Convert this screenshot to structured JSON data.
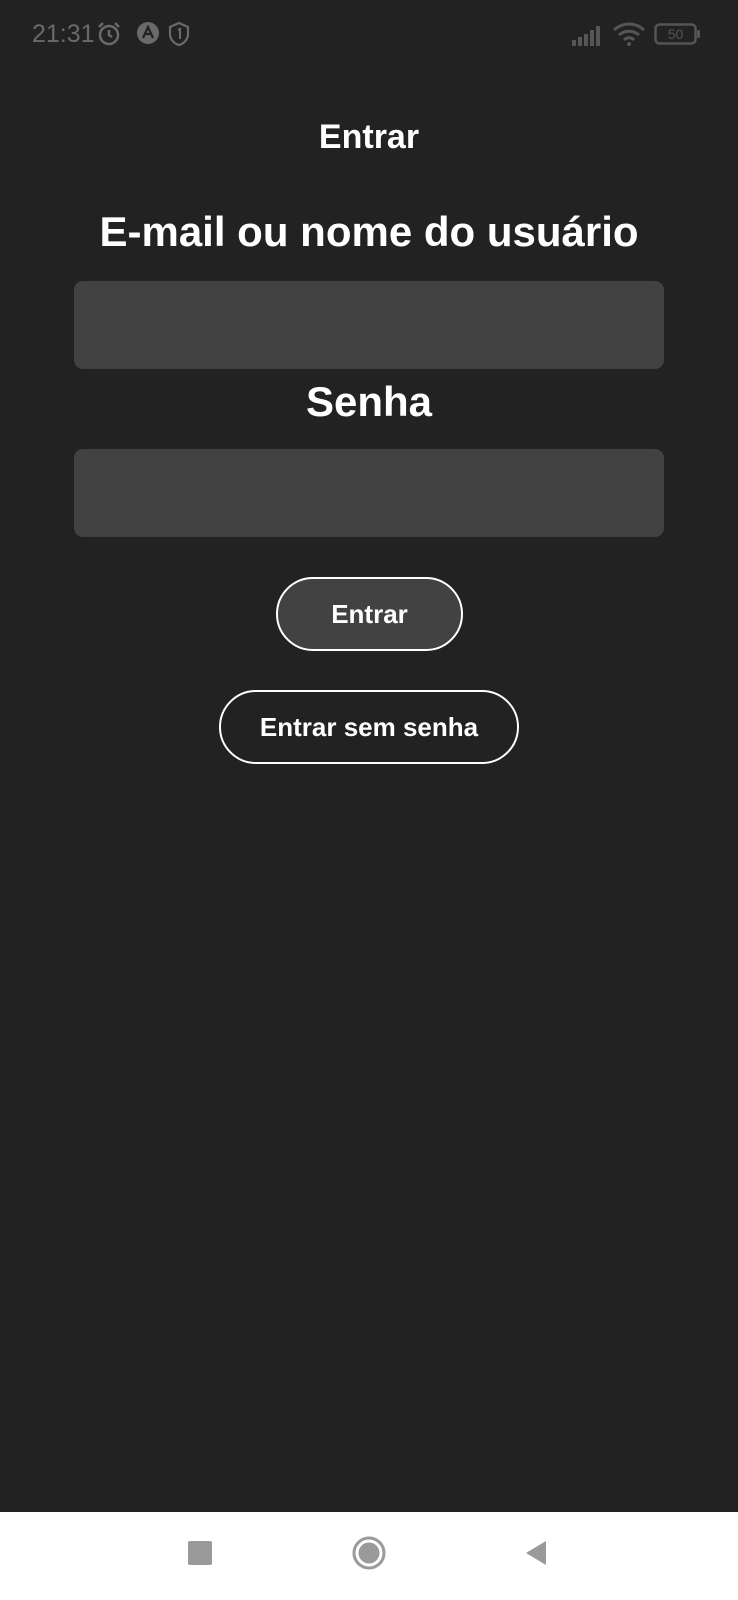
{
  "status_bar": {
    "time": "21:31",
    "battery_level": "50",
    "icons": [
      "alarm-icon",
      "app-notification-icon",
      "shield-icon",
      "signal-icon",
      "wifi-icon",
      "battery-icon"
    ]
  },
  "header": {
    "title": "Entrar"
  },
  "form": {
    "email_label": "E-mail ou nome do usuário",
    "email_value": "",
    "password_label": "Senha",
    "password_value": ""
  },
  "actions": {
    "login_label": "Entrar",
    "passwordless_label": "Entrar sem senha"
  },
  "nav_bar": {
    "icons": [
      "recents-icon",
      "home-icon",
      "back-icon"
    ]
  },
  "colors": {
    "background": "#222222",
    "field": "#424242",
    "text": "#ffffff",
    "nav_background": "#ffffff",
    "nav_icon": "#9a9a9a"
  }
}
